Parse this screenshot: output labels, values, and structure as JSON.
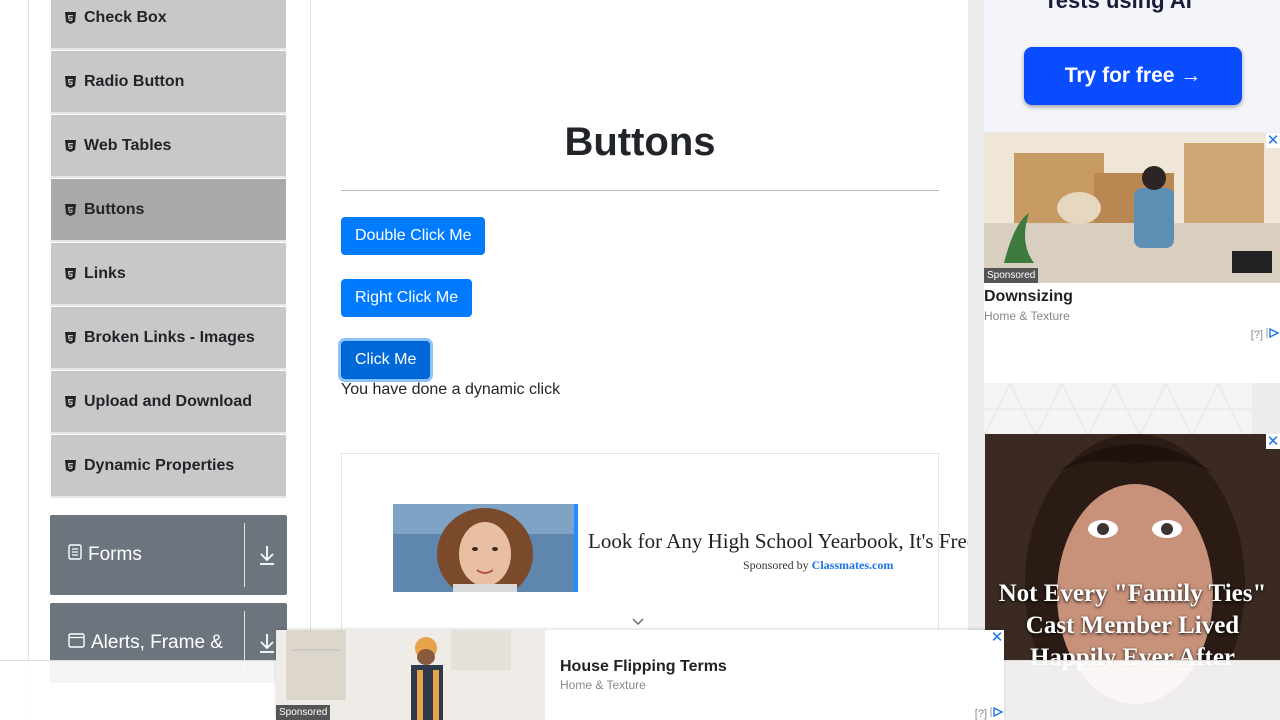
{
  "sidebar": {
    "items": [
      {
        "label": "Check Box",
        "icon": "html5-icon",
        "active": false
      },
      {
        "label": "Radio Button",
        "icon": "html5-icon",
        "active": false
      },
      {
        "label": "Web Tables",
        "icon": "html5-icon",
        "active": false
      },
      {
        "label": "Buttons",
        "icon": "html5-icon",
        "active": true
      },
      {
        "label": "Links",
        "icon": "html5-icon",
        "active": false
      },
      {
        "label": "Broken Links - Images",
        "icon": "html5-icon",
        "active": false
      },
      {
        "label": "Upload and Download",
        "icon": "html5-icon",
        "active": false
      },
      {
        "label": "Dynamic Properties",
        "icon": "html5-icon",
        "active": false
      }
    ],
    "groups": [
      {
        "label": "Forms",
        "icon": "document-icon"
      },
      {
        "label": "Alerts, Frame &",
        "icon": "window-icon"
      }
    ]
  },
  "main": {
    "title": "Buttons",
    "buttons": {
      "double_click": "Double Click Me",
      "right_click": "Right Click Me",
      "click": "Click Me"
    },
    "dynamic_message": "You have done a dynamic click"
  },
  "inline_ad": {
    "headline": "Look for Any High School Yearbook, It's Free",
    "sponsored_by": "Sponsored by",
    "brand": "Classmates.com"
  },
  "right_ads": {
    "promo_text": "Tests using AI",
    "promo_button": "Try for free →",
    "card": {
      "tag": "Sponsored",
      "title": "Downsizing",
      "source": "Home & Texture",
      "help": "[?]"
    },
    "face_headline": "Not Every \"Family Ties\" Cast Member Lived Happily Ever After"
  },
  "bottom_ad": {
    "tag": "Sponsored",
    "title": "House Flipping Terms",
    "source": "Home & Texture",
    "help": "[?]"
  },
  "colors": {
    "primary_button": "#007bff",
    "menu_item_bg": "#c8c8c8",
    "menu_item_active_bg": "#a9a9a9",
    "group_header_bg": "#6c757d",
    "promo_button_bg": "#0a4cff"
  }
}
